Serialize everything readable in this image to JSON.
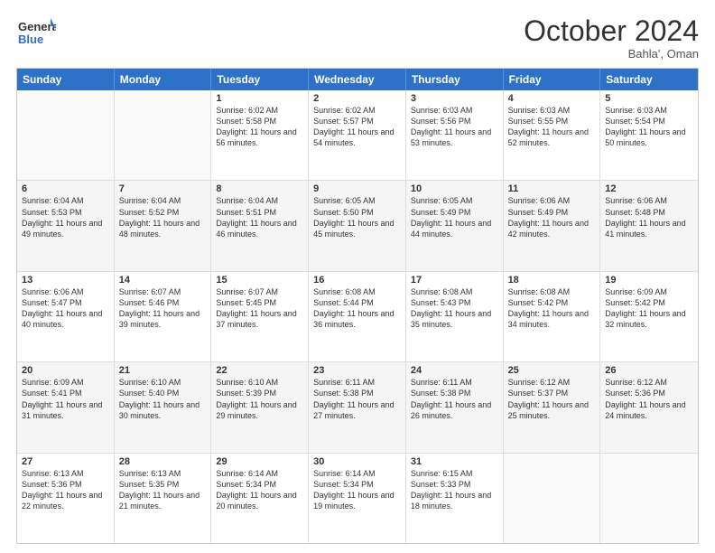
{
  "logo": {
    "line1": "General",
    "line2": "Blue"
  },
  "title": "October 2024",
  "location": "Bahla', Oman",
  "weekdays": [
    "Sunday",
    "Monday",
    "Tuesday",
    "Wednesday",
    "Thursday",
    "Friday",
    "Saturday"
  ],
  "rows": [
    [
      {
        "day": "",
        "info": ""
      },
      {
        "day": "",
        "info": ""
      },
      {
        "day": "1",
        "info": "Sunrise: 6:02 AM\nSunset: 5:58 PM\nDaylight: 11 hours and 56 minutes."
      },
      {
        "day": "2",
        "info": "Sunrise: 6:02 AM\nSunset: 5:57 PM\nDaylight: 11 hours and 54 minutes."
      },
      {
        "day": "3",
        "info": "Sunrise: 6:03 AM\nSunset: 5:56 PM\nDaylight: 11 hours and 53 minutes."
      },
      {
        "day": "4",
        "info": "Sunrise: 6:03 AM\nSunset: 5:55 PM\nDaylight: 11 hours and 52 minutes."
      },
      {
        "day": "5",
        "info": "Sunrise: 6:03 AM\nSunset: 5:54 PM\nDaylight: 11 hours and 50 minutes."
      }
    ],
    [
      {
        "day": "6",
        "info": "Sunrise: 6:04 AM\nSunset: 5:53 PM\nDaylight: 11 hours and 49 minutes."
      },
      {
        "day": "7",
        "info": "Sunrise: 6:04 AM\nSunset: 5:52 PM\nDaylight: 11 hours and 48 minutes."
      },
      {
        "day": "8",
        "info": "Sunrise: 6:04 AM\nSunset: 5:51 PM\nDaylight: 11 hours and 46 minutes."
      },
      {
        "day": "9",
        "info": "Sunrise: 6:05 AM\nSunset: 5:50 PM\nDaylight: 11 hours and 45 minutes."
      },
      {
        "day": "10",
        "info": "Sunrise: 6:05 AM\nSunset: 5:49 PM\nDaylight: 11 hours and 44 minutes."
      },
      {
        "day": "11",
        "info": "Sunrise: 6:06 AM\nSunset: 5:49 PM\nDaylight: 11 hours and 42 minutes."
      },
      {
        "day": "12",
        "info": "Sunrise: 6:06 AM\nSunset: 5:48 PM\nDaylight: 11 hours and 41 minutes."
      }
    ],
    [
      {
        "day": "13",
        "info": "Sunrise: 6:06 AM\nSunset: 5:47 PM\nDaylight: 11 hours and 40 minutes."
      },
      {
        "day": "14",
        "info": "Sunrise: 6:07 AM\nSunset: 5:46 PM\nDaylight: 11 hours and 39 minutes."
      },
      {
        "day": "15",
        "info": "Sunrise: 6:07 AM\nSunset: 5:45 PM\nDaylight: 11 hours and 37 minutes."
      },
      {
        "day": "16",
        "info": "Sunrise: 6:08 AM\nSunset: 5:44 PM\nDaylight: 11 hours and 36 minutes."
      },
      {
        "day": "17",
        "info": "Sunrise: 6:08 AM\nSunset: 5:43 PM\nDaylight: 11 hours and 35 minutes."
      },
      {
        "day": "18",
        "info": "Sunrise: 6:08 AM\nSunset: 5:42 PM\nDaylight: 11 hours and 34 minutes."
      },
      {
        "day": "19",
        "info": "Sunrise: 6:09 AM\nSunset: 5:42 PM\nDaylight: 11 hours and 32 minutes."
      }
    ],
    [
      {
        "day": "20",
        "info": "Sunrise: 6:09 AM\nSunset: 5:41 PM\nDaylight: 11 hours and 31 minutes."
      },
      {
        "day": "21",
        "info": "Sunrise: 6:10 AM\nSunset: 5:40 PM\nDaylight: 11 hours and 30 minutes."
      },
      {
        "day": "22",
        "info": "Sunrise: 6:10 AM\nSunset: 5:39 PM\nDaylight: 11 hours and 29 minutes."
      },
      {
        "day": "23",
        "info": "Sunrise: 6:11 AM\nSunset: 5:38 PM\nDaylight: 11 hours and 27 minutes."
      },
      {
        "day": "24",
        "info": "Sunrise: 6:11 AM\nSunset: 5:38 PM\nDaylight: 11 hours and 26 minutes."
      },
      {
        "day": "25",
        "info": "Sunrise: 6:12 AM\nSunset: 5:37 PM\nDaylight: 11 hours and 25 minutes."
      },
      {
        "day": "26",
        "info": "Sunrise: 6:12 AM\nSunset: 5:36 PM\nDaylight: 11 hours and 24 minutes."
      }
    ],
    [
      {
        "day": "27",
        "info": "Sunrise: 6:13 AM\nSunset: 5:36 PM\nDaylight: 11 hours and 22 minutes."
      },
      {
        "day": "28",
        "info": "Sunrise: 6:13 AM\nSunset: 5:35 PM\nDaylight: 11 hours and 21 minutes."
      },
      {
        "day": "29",
        "info": "Sunrise: 6:14 AM\nSunset: 5:34 PM\nDaylight: 11 hours and 20 minutes."
      },
      {
        "day": "30",
        "info": "Sunrise: 6:14 AM\nSunset: 5:34 PM\nDaylight: 11 hours and 19 minutes."
      },
      {
        "day": "31",
        "info": "Sunrise: 6:15 AM\nSunset: 5:33 PM\nDaylight: 11 hours and 18 minutes."
      },
      {
        "day": "",
        "info": ""
      },
      {
        "day": "",
        "info": ""
      }
    ]
  ]
}
